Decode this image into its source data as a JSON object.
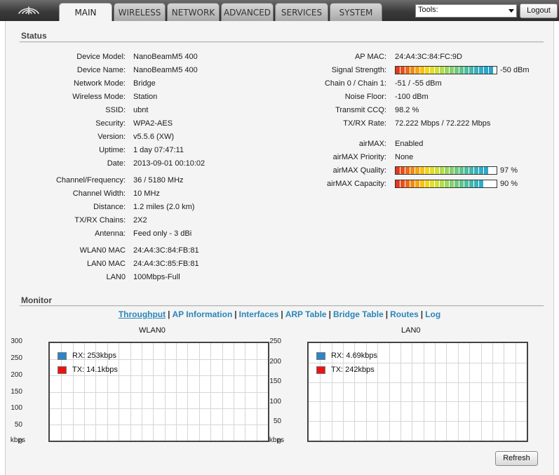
{
  "nav": {
    "tabs": [
      {
        "label": "MAIN",
        "active": true
      },
      {
        "label": "WIRELESS",
        "active": false
      },
      {
        "label": "NETWORK",
        "active": false
      },
      {
        "label": "ADVANCED",
        "active": false
      },
      {
        "label": "SERVICES",
        "active": false
      },
      {
        "label": "SYSTEM",
        "active": false
      }
    ],
    "tools_label": "Tools:",
    "logout_label": "Logout"
  },
  "status": {
    "title": "Status",
    "left": [
      {
        "label": "Device Model:",
        "value": "NanoBeamM5 400"
      },
      {
        "label": "Device Name:",
        "value": "NanoBeamM5 400"
      },
      {
        "label": "Network Mode:",
        "value": "Bridge"
      },
      {
        "label": "Wireless Mode:",
        "value": "Station"
      },
      {
        "label": "SSID:",
        "value": "ubnt"
      },
      {
        "label": "Security:",
        "value": "WPA2-AES"
      },
      {
        "label": "Version:",
        "value": "v5.5.6 (XW)"
      },
      {
        "label": "Uptime:",
        "value": "1 day 07:47:11"
      },
      {
        "label": "Date:",
        "value": "2013-09-01 00:10:02"
      },
      {
        "label": "Channel/Frequency:",
        "value": "36 / 5180 MHz"
      },
      {
        "label": "Channel Width:",
        "value": "10 MHz"
      },
      {
        "label": "Distance:",
        "value": "1.2 miles (2.0 km)"
      },
      {
        "label": "TX/RX Chains:",
        "value": "2X2"
      },
      {
        "label": "Antenna:",
        "value": "Feed only - 3 dBi"
      },
      {
        "label": "WLAN0 MAC",
        "value": "24:A4:3C:84:FB:81"
      },
      {
        "label": "LAN0 MAC",
        "value": "24:A4:3C:85:FB:81"
      },
      {
        "label": "LAN0",
        "value": "100Mbps-Full"
      }
    ],
    "right": [
      {
        "label": "AP MAC:",
        "value": "24:A4:3C:84:FC:9D"
      },
      {
        "label": "Signal Strength:",
        "value": "-50 dBm",
        "meter_level": 1.0
      },
      {
        "label": "Chain 0 / Chain 1:",
        "value": "-51 / -55 dBm"
      },
      {
        "label": "Noise Floor:",
        "value": "-100 dBm"
      },
      {
        "label": "Transmit CCQ:",
        "value": "98.2 %"
      },
      {
        "label": "TX/RX Rate:",
        "value": "72.222 Mbps / 72.222 Mbps"
      },
      {
        "label": "airMAX:",
        "value": "Enabled"
      },
      {
        "label": "airMAX Priority:",
        "value": "None"
      },
      {
        "label": "airMAX Quality:",
        "value": "97 %",
        "meter_level": 0.97
      },
      {
        "label": "airMAX Capacity:",
        "value": "90 %",
        "meter_level": 0.9
      }
    ],
    "meter_colors": [
      "#e03a1e",
      "#e8501a",
      "#ee6a18",
      "#f28a16",
      "#f6a414",
      "#f8c012",
      "#f4d41a",
      "#e4dc2a",
      "#cde038",
      "#b4dc48",
      "#9cd65a",
      "#86d06c",
      "#70ca7e",
      "#5ec48e",
      "#4ebea0",
      "#42b8ae",
      "#38b2bc",
      "#30acc6",
      "#2aa6cc",
      "#26a2d0"
    ]
  },
  "monitor": {
    "title": "Monitor",
    "links": [
      {
        "label": "Throughput",
        "active": true
      },
      {
        "label": "AP Information",
        "active": false
      },
      {
        "label": "Interfaces",
        "active": false
      },
      {
        "label": "ARP Table",
        "active": false
      },
      {
        "label": "Bridge Table",
        "active": false
      },
      {
        "label": "Routes",
        "active": false
      },
      {
        "label": "Log",
        "active": false
      }
    ],
    "graphs": [
      {
        "title": "WLAN0",
        "unit": "kbps",
        "y_ticks": [
          "300",
          "250",
          "200",
          "150",
          "100",
          "50",
          "0"
        ],
        "rx": "RX: 253kbps",
        "tx": "TX: 14.1kbps"
      },
      {
        "title": "LAN0",
        "unit": "kbps",
        "y_ticks": [
          "250",
          "200",
          "150",
          "100",
          "50",
          "0"
        ],
        "rx": "RX: 4.69kbps",
        "tx": "TX: 242kbps"
      }
    ],
    "rx_color": "#2a86c8",
    "tx_color": "#ee1111",
    "refresh_label": "Refresh"
  }
}
